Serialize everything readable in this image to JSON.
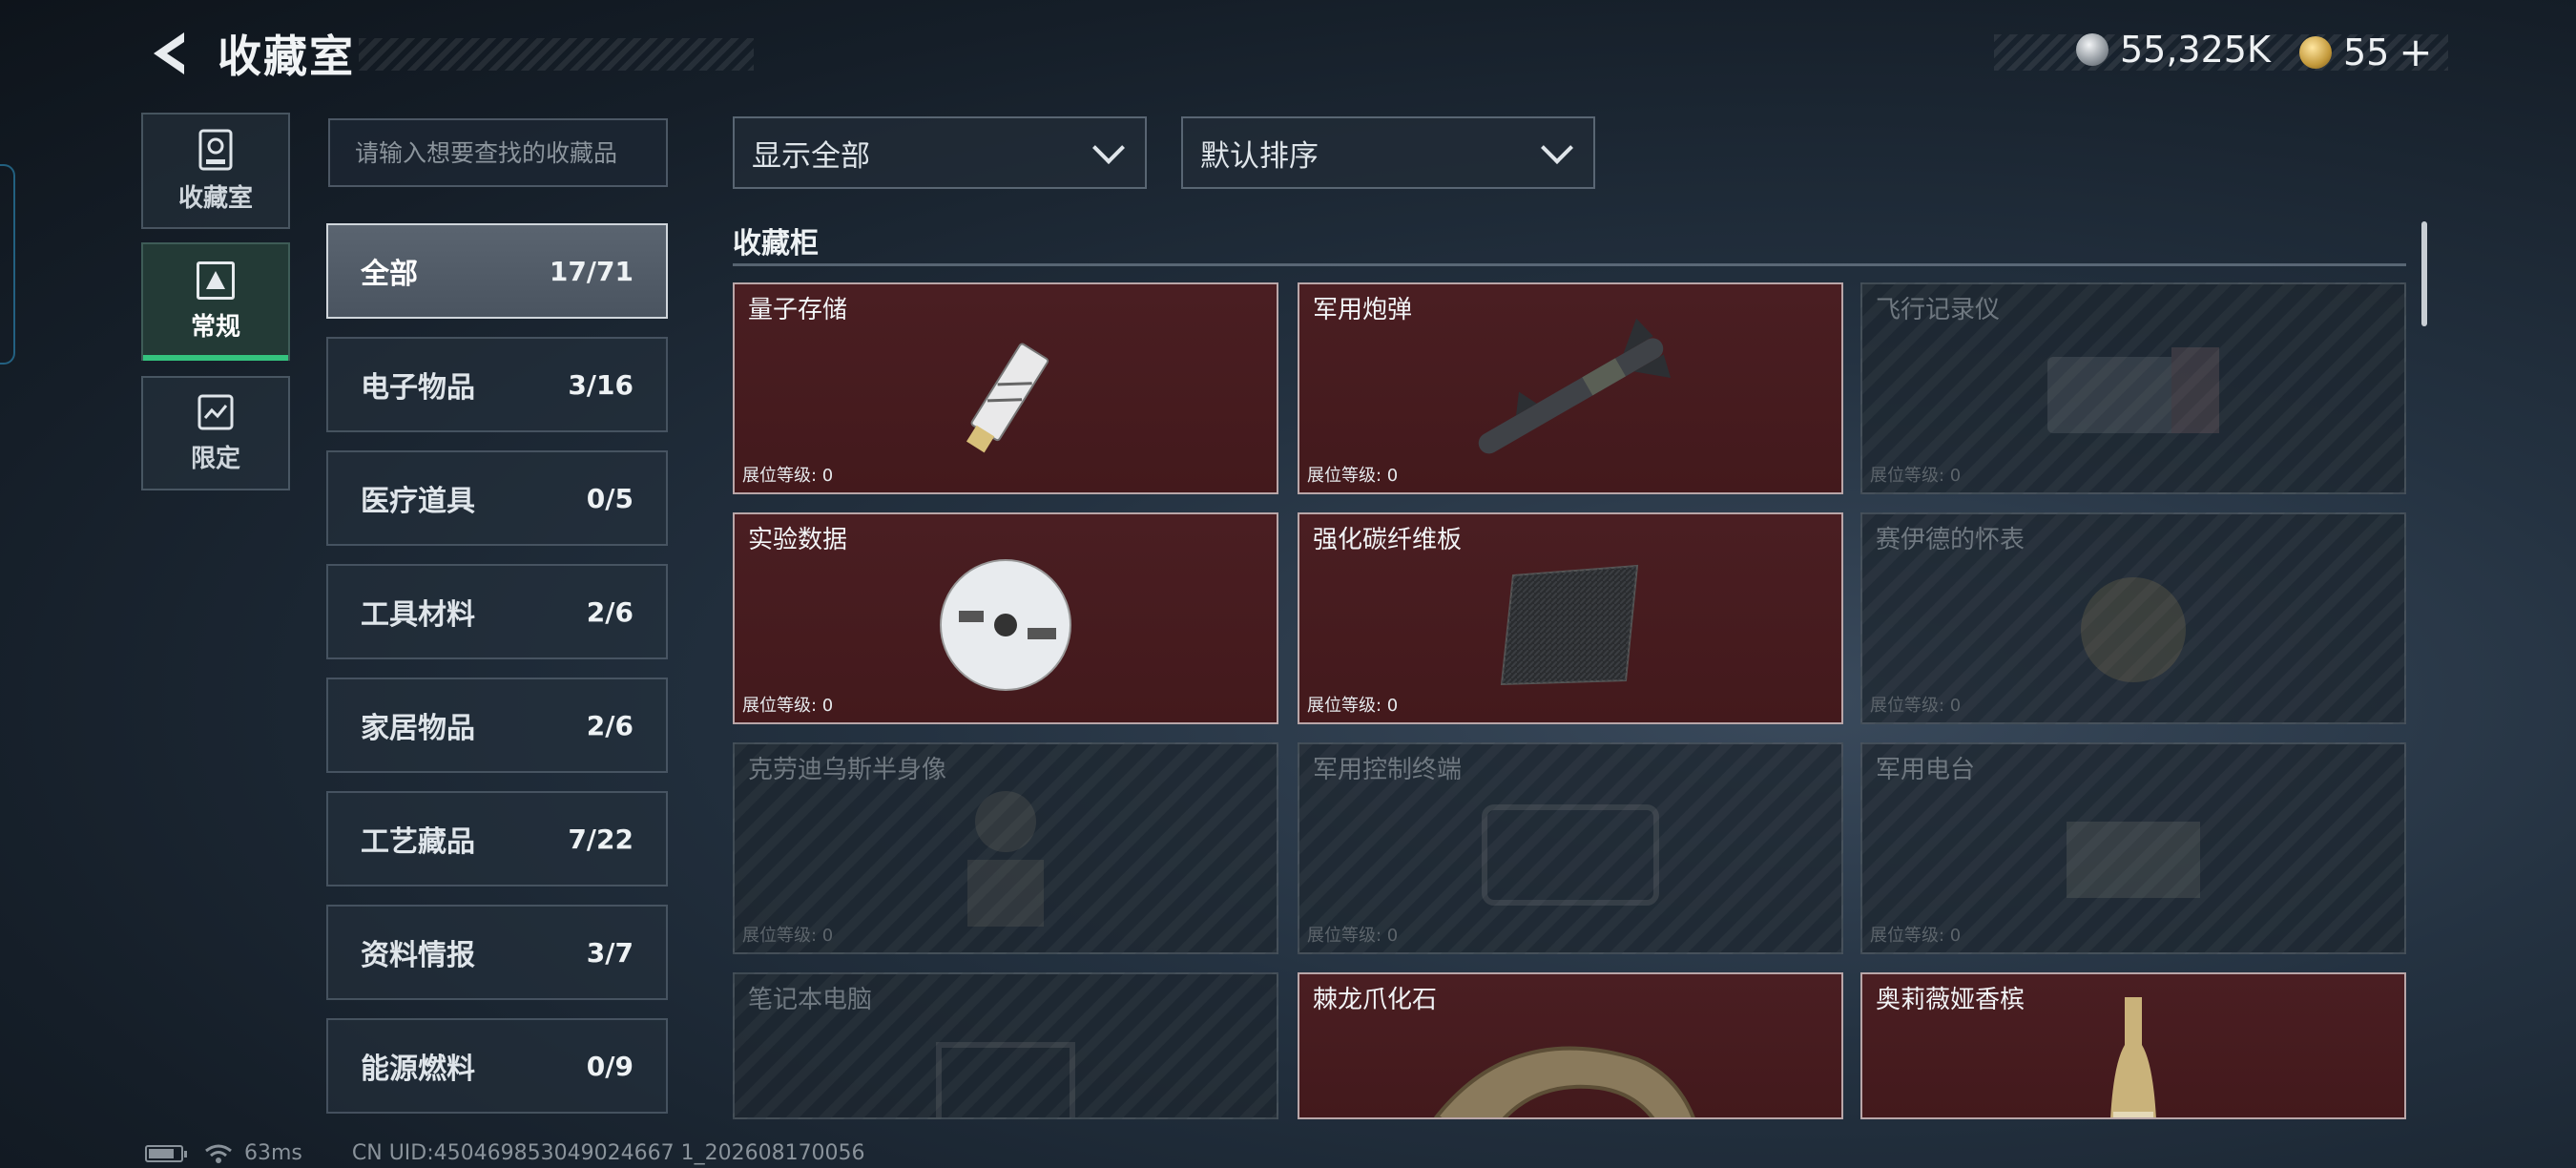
{
  "header": {
    "title": "收藏室",
    "currency_silver": "55,325K",
    "currency_gold": "55",
    "plus": "+"
  },
  "nav": [
    {
      "label": "收藏室",
      "icon": "collection-room-icon"
    },
    {
      "label": "常规",
      "icon": "regular-icon",
      "active": true
    },
    {
      "label": "限定",
      "icon": "limited-icon"
    }
  ],
  "search": {
    "placeholder": "请输入想要查找的收藏品"
  },
  "categories": [
    {
      "label": "全部",
      "count": "17/71",
      "active": true
    },
    {
      "label": "电子物品",
      "count": "3/16"
    },
    {
      "label": "医疗道具",
      "count": "0/5"
    },
    {
      "label": "工具材料",
      "count": "2/6"
    },
    {
      "label": "家居物品",
      "count": "2/6"
    },
    {
      "label": "工艺藏品",
      "count": "7/22"
    },
    {
      "label": "资料情报",
      "count": "3/7"
    },
    {
      "label": "能源燃料",
      "count": "0/9"
    }
  ],
  "filters": {
    "show": "显示全部",
    "sort": "默认排序"
  },
  "section_title": "收藏柜",
  "level_label": "展位等级: 0",
  "items": [
    {
      "name": "量子存储",
      "owned": true,
      "icon": "usb-drive-icon"
    },
    {
      "name": "军用炮弹",
      "owned": true,
      "icon": "missile-icon"
    },
    {
      "name": "飞行记录仪",
      "owned": false,
      "icon": "flight-recorder-icon"
    },
    {
      "name": "实验数据",
      "owned": true,
      "icon": "disc-icon"
    },
    {
      "name": "强化碳纤维板",
      "owned": true,
      "icon": "carbon-plate-icon"
    },
    {
      "name": "赛伊德的怀表",
      "owned": false,
      "icon": "pocket-watch-icon"
    },
    {
      "name": "克劳迪乌斯半身像",
      "owned": false,
      "icon": "bust-icon"
    },
    {
      "name": "军用控制终端",
      "owned": false,
      "icon": "control-terminal-icon"
    },
    {
      "name": "军用电台",
      "owned": false,
      "icon": "radio-icon"
    },
    {
      "name": "笔记本电脑",
      "owned": false,
      "icon": "laptop-icon"
    },
    {
      "name": "棘龙爪化石",
      "owned": true,
      "icon": "claw-fossil-icon"
    },
    {
      "name": "奥莉薇娅香槟",
      "owned": true,
      "icon": "champagne-icon"
    }
  ],
  "footer": {
    "ping": "63ms",
    "uid": "CN UID:450469853049024667 1_202608170056"
  }
}
